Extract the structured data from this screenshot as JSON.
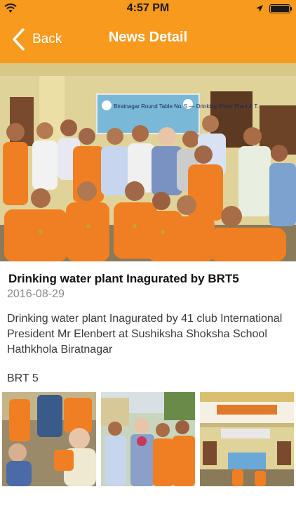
{
  "status_bar": {
    "time": "4:57 PM"
  },
  "nav": {
    "back_label": "Back",
    "title": "News Detail"
  },
  "hero_image": {
    "banner_text": "Biratnagar Round Table No. 5 — Drinking Water Plant & T..."
  },
  "news": {
    "title": "Drinking water plant Inagurated by BRT5",
    "date": "2016-08-29",
    "body": "Drinking water plant Inagurated by 41 club International President Mr Elenbert at Sushiksha Shoksha School Hathkhola Biratnagar"
  },
  "gallery": {
    "label": "BRT 5",
    "images": [
      {
        "name": "child-with-guests-photo"
      },
      {
        "name": "group-with-guest-photo"
      },
      {
        "name": "school-building-photo"
      }
    ]
  },
  "colors": {
    "accent": "#f79a1e",
    "title_text": "#111111",
    "date_text": "#8a8a8a"
  }
}
